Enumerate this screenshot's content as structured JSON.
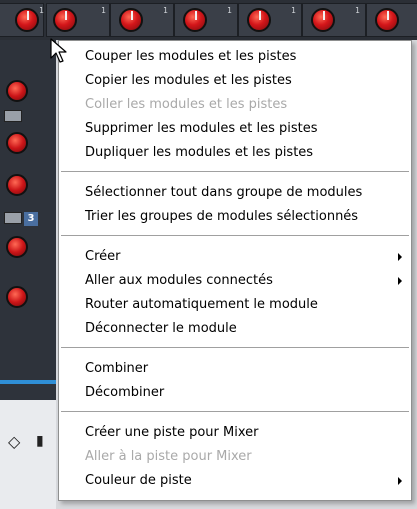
{
  "background": {
    "module_number": "3",
    "knob_scale_marks": [
      "1",
      "1",
      "1",
      "1",
      "1",
      "1"
    ],
    "colors": {
      "panel_dark": "#2b2f36",
      "knob_red": "#d4161a",
      "accent_blue": "#2f8fd6"
    }
  },
  "context_menu": {
    "sections": [
      {
        "items": [
          {
            "label": "Couper les modules et les pistes",
            "enabled": true
          },
          {
            "label": "Copier les modules et les pistes",
            "enabled": true
          },
          {
            "label": "Coller les modules et les pistes",
            "enabled": false
          },
          {
            "label": "Supprimer les modules et les pistes",
            "enabled": true
          },
          {
            "label": "Dupliquer les modules et les pistes",
            "enabled": true
          }
        ]
      },
      {
        "items": [
          {
            "label": "Sélectionner tout dans groupe de modules",
            "enabled": true
          },
          {
            "label": "Trier les groupes de modules sélectionnés",
            "enabled": true
          }
        ]
      },
      {
        "items": [
          {
            "label": "Créer",
            "enabled": true,
            "submenu": true
          },
          {
            "label": "Aller aux modules connectés",
            "enabled": true,
            "submenu": true
          },
          {
            "label": "Router automatiquement le module",
            "enabled": true
          },
          {
            "label": "Déconnecter le module",
            "enabled": true
          }
        ]
      },
      {
        "items": [
          {
            "label": "Combiner",
            "enabled": true
          },
          {
            "label": "Décombiner",
            "enabled": true
          }
        ]
      },
      {
        "items": [
          {
            "label": "Créer une piste pour Mixer",
            "enabled": true
          },
          {
            "label": "Aller à la piste pour Mixer",
            "enabled": false
          },
          {
            "label": "Couleur de piste",
            "enabled": true,
            "submenu": true
          }
        ]
      }
    ]
  }
}
